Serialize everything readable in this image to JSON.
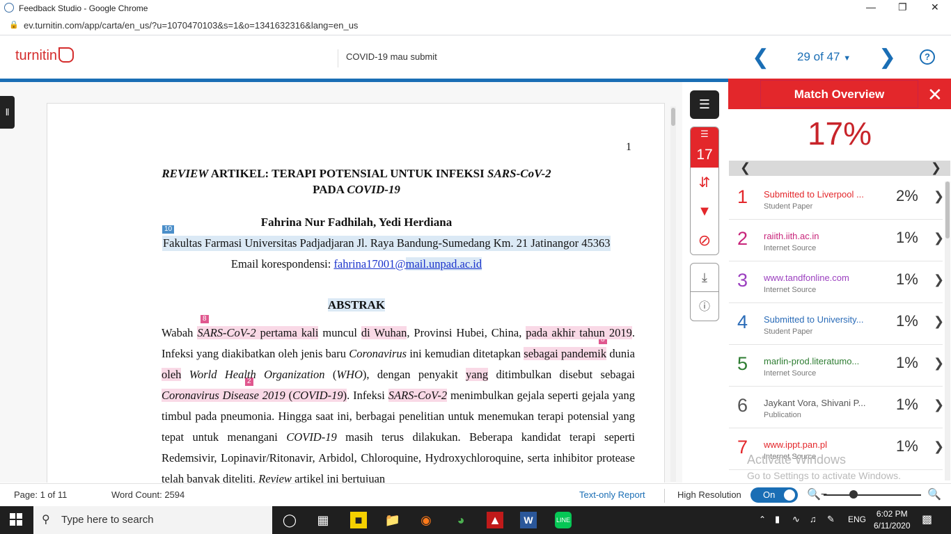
{
  "window": {
    "title": "Feedback Studio - Google Chrome",
    "url": "ev.turnitin.com/app/carta/en_us/?u=1070470103&s=1&o=1341632316&lang=en_us"
  },
  "header": {
    "logo_text": "turnitin",
    "doc_title": "COVID-19 mau submit",
    "page_selector": "29 of 47",
    "help_label": "?"
  },
  "tools": {
    "similarity_count": "17"
  },
  "document": {
    "page_number": "1",
    "title_line1_italic": "REVIEW",
    "title_line1_rest": " ARTIKEL: TERAPI POTENSIAL UNTUK INFEKSI ",
    "title_line1_tail": "SARS-CoV-2",
    "title_line2_a": "PADA ",
    "title_line2_b": "COVID-19",
    "authors": "Fahrina Nur Fadhilah, Yedi Herdiana",
    "affiliation_badge": "10",
    "affiliation": "Fakultas Farmasi Universitas Padjadjaran Jl. Raya Bandung-Sumedang Km. 21 Jatinangor 45363",
    "email_label": "Email korespondensi: ",
    "email_user": "fahrina17001@",
    "email_domain": "mail.unpad.ac.id",
    "abstract_heading": "ABSTRAK",
    "badge_8a": "8",
    "badge_8b": "8",
    "badge_2": "2"
  },
  "match_panel": {
    "title": "Match Overview",
    "overall_percent": "17%",
    "matches": [
      {
        "num": "1",
        "source": "Submitted to Liverpool ...",
        "type": "Student Paper",
        "percent": "2%",
        "color": "#e3272b"
      },
      {
        "num": "2",
        "source": "raiith.iith.ac.in",
        "type": "Internet Source",
        "percent": "1%",
        "color": "#c8247a"
      },
      {
        "num": "3",
        "source": "www.tandfonline.com",
        "type": "Internet Source",
        "percent": "1%",
        "color": "#9b3fbf"
      },
      {
        "num": "4",
        "source": "Submitted to University...",
        "type": "Student Paper",
        "percent": "1%",
        "color": "#2b6cb8"
      },
      {
        "num": "5",
        "source": "marlin-prod.literatumo...",
        "type": "Internet Source",
        "percent": "1%",
        "color": "#2e7d32"
      },
      {
        "num": "6",
        "source": "Jaykant Vora, Shivani P...",
        "type": "Publication",
        "percent": "1%",
        "color": "#555555"
      },
      {
        "num": "7",
        "source": "www.ippt.pan.pl",
        "type": "Internet Source",
        "percent": "1%",
        "color": "#e3272b"
      }
    ],
    "watermark_title": "Activate Windows",
    "watermark_sub": "Go to Settings to activate Windows."
  },
  "status": {
    "page": "Page: 1 of 11",
    "word_count": "Word Count: 2594",
    "text_only": "Text-only Report",
    "high_res": "High Resolution",
    "toggle": "On"
  },
  "taskbar": {
    "search_placeholder": "Type here to search",
    "lang": "ENG",
    "time": "6:02 PM",
    "date": "6/11/2020"
  }
}
